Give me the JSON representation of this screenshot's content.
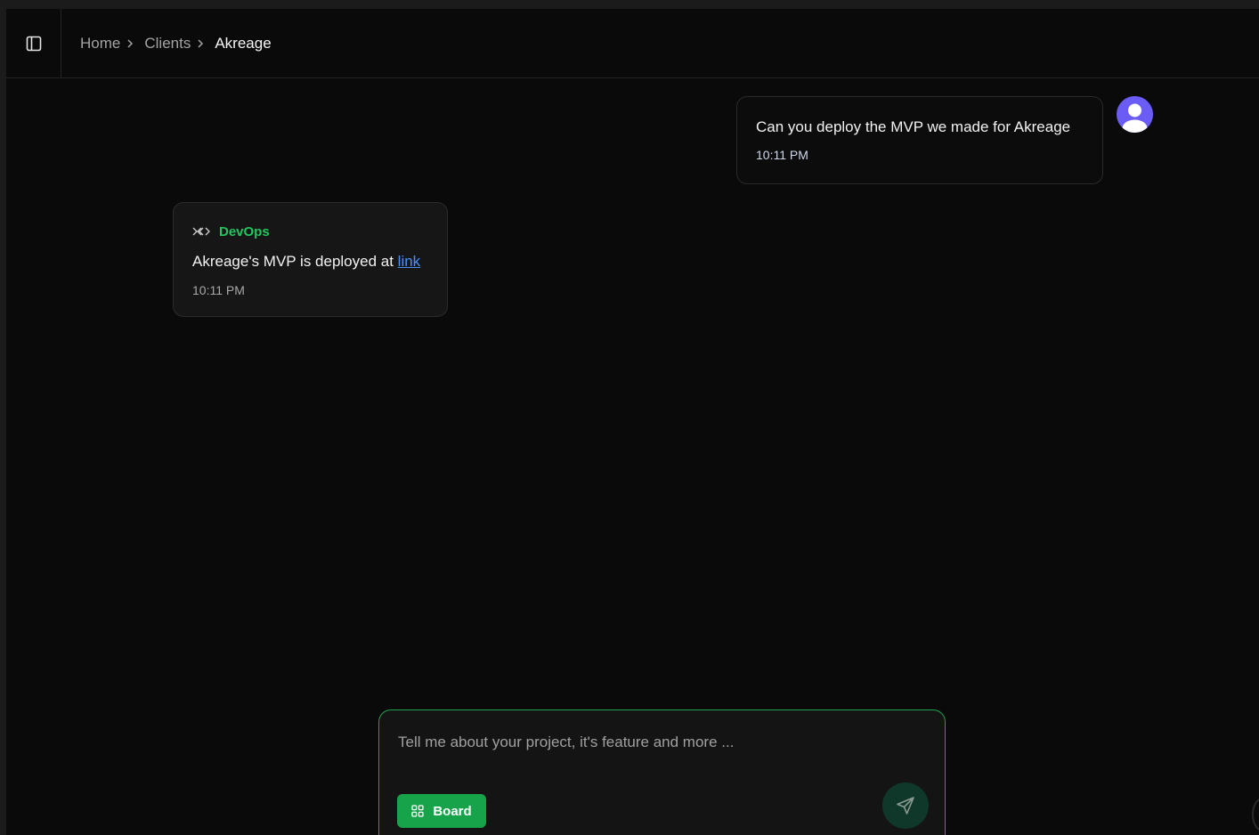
{
  "breadcrumb": {
    "items": [
      "Home",
      "Clients"
    ],
    "current": "Akreage"
  },
  "chat": {
    "user_message": {
      "text": "Can you deploy the MVP we made for Akreage",
      "time": "10:11 PM"
    },
    "agent_message": {
      "agent_name": "DevOps",
      "text_before_link": "Akreage's MVP is deployed at ",
      "link_text": "link",
      "time": "10:11 PM"
    }
  },
  "composer": {
    "placeholder": "Tell me about your project, it's feature and more ...",
    "board_label": "Board"
  },
  "icons": {
    "sidebar_toggle": "panel-left-icon",
    "breadcrumb_separator": "chevron-right-icon",
    "avatar": "user-avatar-icon",
    "agent": "code-brackets-icon",
    "board": "grid-icon",
    "send": "send-icon"
  },
  "colors": {
    "accent_green": "#22c55e",
    "button_green": "#16a34a",
    "link_blue": "#4f8ff0",
    "avatar_purple": "#6b5cf6",
    "background": "#0a0a0a"
  }
}
